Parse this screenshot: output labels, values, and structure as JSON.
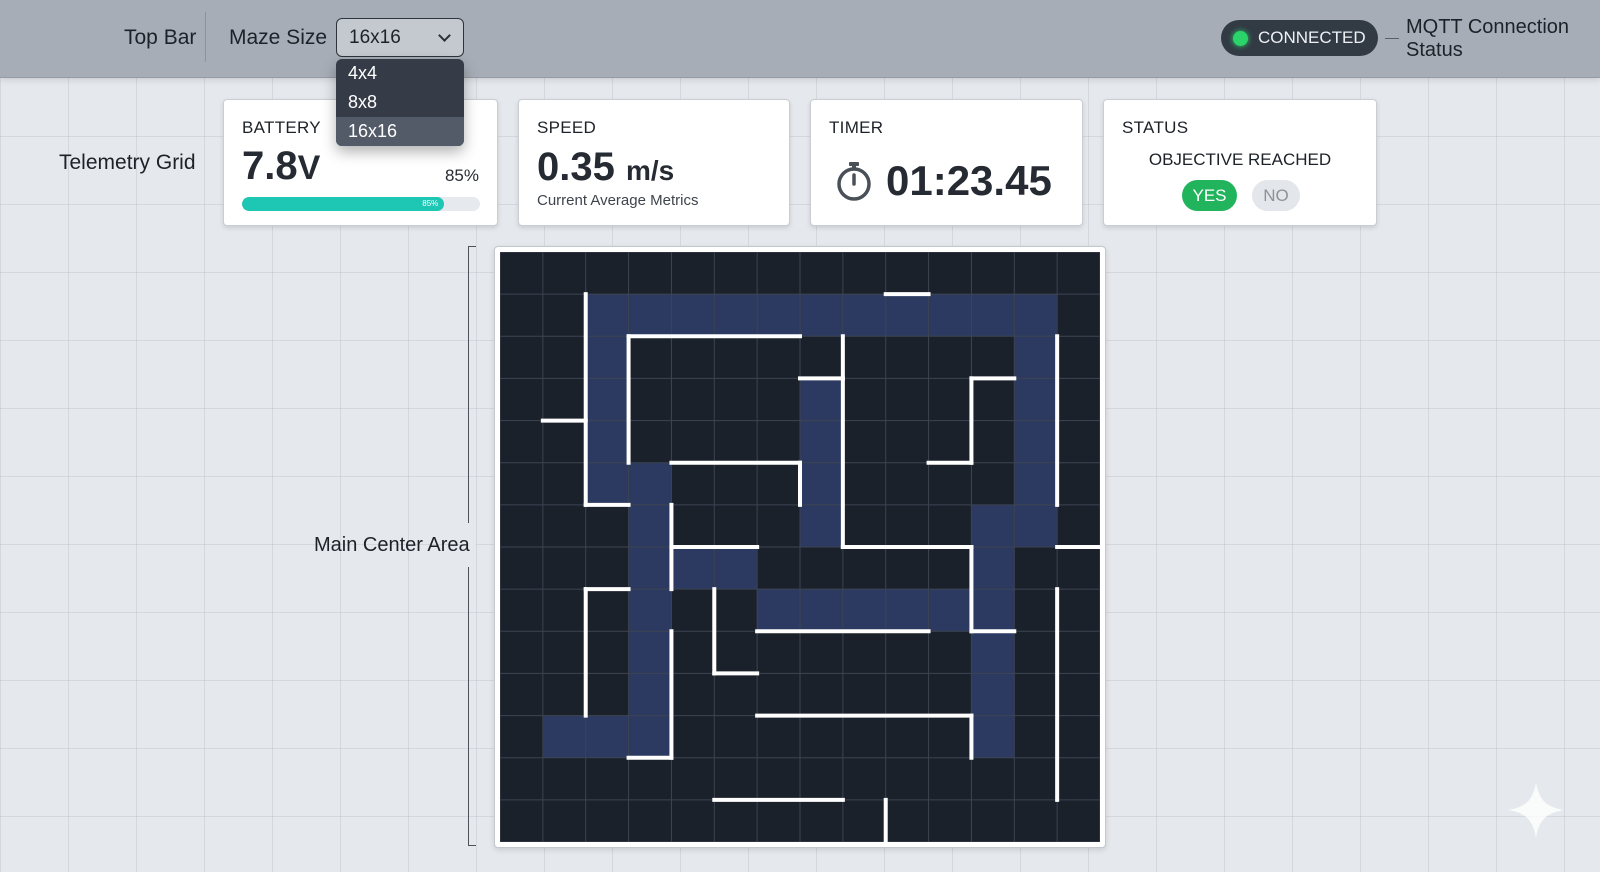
{
  "annotations": {
    "top_bar": "Top Bar",
    "telemetry_grid": "Telemetry Grid",
    "main_center_area": "Main Center Area",
    "mqtt_status": "MQTT Connection\nStatus"
  },
  "maze_size": {
    "label": "Maze Size",
    "selected": "16x16",
    "options": [
      "4x4",
      "8x8",
      "16x16"
    ]
  },
  "connection": {
    "label": "CONNECTED",
    "color": "#2bd46a"
  },
  "battery": {
    "title": "BATTERY",
    "voltage": "7.8",
    "unit": "V",
    "percent_label": "85%",
    "fill_label": "85%",
    "level": 0.85,
    "color": "#1ec6b4"
  },
  "speed": {
    "title": "SPEED",
    "value": "0.35",
    "unit": "m/s",
    "caption": "Current Average Metrics"
  },
  "timer": {
    "title": "TIMER",
    "value": "01:23.45",
    "icon": "stopwatch-icon"
  },
  "status": {
    "title": "STATUS",
    "label": "OBJECTIVE REACHED",
    "yes_label": "YES",
    "no_label": "NO",
    "active": "YES"
  },
  "maze": {
    "grid_size": 14,
    "background": "#1b212b",
    "grid_line_color": "#3c4452",
    "path_color": "#3b4f8c",
    "wall_color": "#ffffff",
    "path_cells": [
      [
        2,
        1
      ],
      [
        3,
        1
      ],
      [
        4,
        1
      ],
      [
        5,
        1
      ],
      [
        6,
        1
      ],
      [
        7,
        1
      ],
      [
        8,
        1
      ],
      [
        9,
        1
      ],
      [
        10,
        1
      ],
      [
        11,
        1
      ],
      [
        12,
        1
      ],
      [
        2,
        2
      ],
      [
        12,
        2
      ],
      [
        2,
        3
      ],
      [
        7,
        3
      ],
      [
        12,
        3
      ],
      [
        2,
        4
      ],
      [
        7,
        4
      ],
      [
        12,
        4
      ],
      [
        2,
        5
      ],
      [
        3,
        5
      ],
      [
        7,
        5
      ],
      [
        12,
        5
      ],
      [
        3,
        6
      ],
      [
        7,
        6
      ],
      [
        11,
        6
      ],
      [
        12,
        6
      ],
      [
        3,
        7
      ],
      [
        4,
        7
      ],
      [
        5,
        7
      ],
      [
        11,
        7
      ],
      [
        3,
        8
      ],
      [
        6,
        8
      ],
      [
        7,
        8
      ],
      [
        8,
        8
      ],
      [
        9,
        8
      ],
      [
        10,
        8
      ],
      [
        11,
        8
      ],
      [
        3,
        9
      ],
      [
        11,
        9
      ],
      [
        3,
        10
      ],
      [
        11,
        10
      ],
      [
        1,
        11
      ],
      [
        2,
        11
      ],
      [
        3,
        11
      ],
      [
        11,
        11
      ]
    ],
    "walls": [
      [
        2,
        1,
        2,
        6
      ],
      [
        3,
        2,
        7,
        2
      ],
      [
        8,
        2,
        8,
        7
      ],
      [
        9,
        1,
        10,
        1
      ],
      [
        3,
        2,
        3,
        5
      ],
      [
        7,
        3,
        8,
        3
      ],
      [
        1,
        4,
        2,
        4
      ],
      [
        11,
        3,
        12,
        3
      ],
      [
        11,
        3,
        11,
        5
      ],
      [
        10,
        5,
        11,
        5
      ],
      [
        4,
        5,
        7,
        5
      ],
      [
        7,
        5,
        7,
        6
      ],
      [
        2,
        6,
        3,
        6
      ],
      [
        4,
        6,
        4,
        8
      ],
      [
        13,
        2,
        13,
        6
      ],
      [
        13,
        7,
        14,
        7
      ],
      [
        4,
        7,
        6,
        7
      ],
      [
        8,
        7,
        11,
        7
      ],
      [
        11,
        7,
        11,
        9
      ],
      [
        2,
        8,
        3,
        8
      ],
      [
        2,
        8,
        2,
        11
      ],
      [
        5,
        8,
        5,
        10
      ],
      [
        5,
        10,
        6,
        10
      ],
      [
        6,
        9,
        10,
        9
      ],
      [
        11,
        9,
        12,
        9
      ],
      [
        13,
        8,
        13,
        13
      ],
      [
        4,
        9,
        4,
        12
      ],
      [
        3,
        12,
        4,
        12
      ],
      [
        6,
        11,
        11,
        11
      ],
      [
        11,
        11,
        11,
        12
      ],
      [
        5,
        13,
        8,
        13
      ],
      [
        9,
        13,
        9,
        14
      ]
    ]
  }
}
